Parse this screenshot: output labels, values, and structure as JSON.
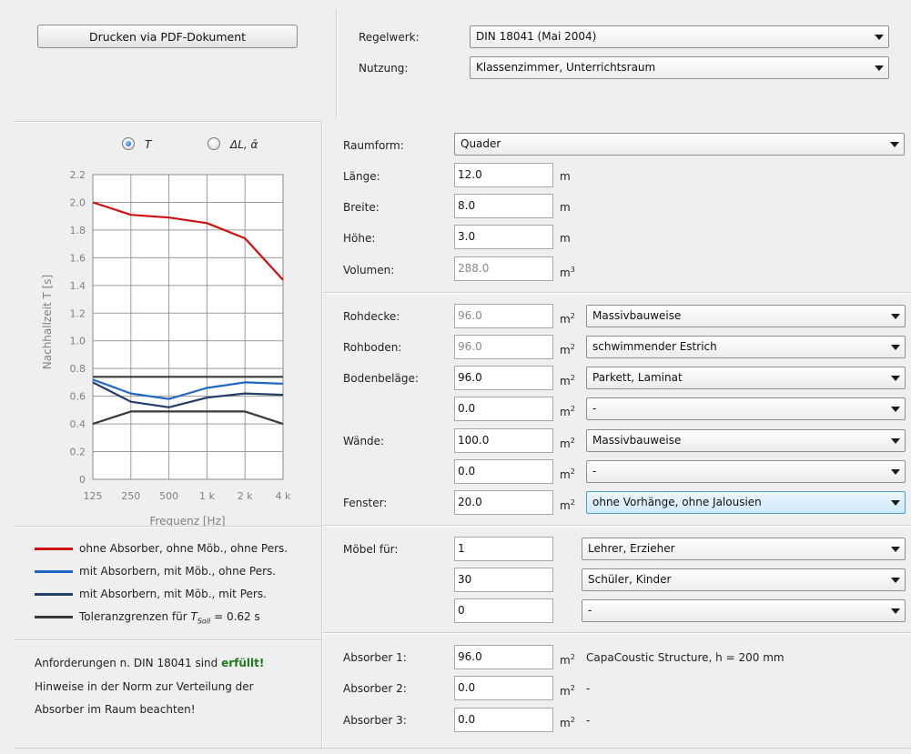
{
  "toolbar": {
    "print_button": "Drucken via PDF-Dokument"
  },
  "settings": {
    "regelwerk_label": "Regelwerk:",
    "regelwerk_value": "DIN 18041 (Mai 2004)",
    "nutzung_label": "Nutzung:",
    "nutzung_value": "Klassenzimmer, Unterrichtsraum"
  },
  "chart_toggle": {
    "opt_t": "T",
    "opt_dl": "ΔL, ᾱ",
    "selected": "T"
  },
  "chart_data": {
    "type": "line",
    "x": [
      "125",
      "250",
      "500",
      "1 k",
      "2 k",
      "4 k"
    ],
    "xlabel": "Frequenz [Hz]",
    "ylabel": "Nachhallzeit T [s]",
    "ylim": [
      0,
      2.2
    ],
    "yticks": [
      "0",
      "0.2",
      "0.4",
      "0.6",
      "0.8",
      "1.0",
      "1.2",
      "1.4",
      "1.6",
      "1.8",
      "2.0",
      "2.2"
    ],
    "grid": true,
    "series": [
      {
        "name": "ohne Absorber, ohne Möb., ohne Pers.",
        "color": "#d01010",
        "values": [
          2.0,
          1.91,
          1.89,
          1.85,
          1.74,
          1.44
        ]
      },
      {
        "name": "mit Absorbern, mit Möb., ohne Pers.",
        "color": "#1f67c4",
        "values": [
          0.72,
          0.62,
          0.58,
          0.66,
          0.7,
          0.69
        ]
      },
      {
        "name": "mit Absorbern, mit Möb., mit Pers.",
        "color": "#243f66",
        "values": [
          0.7,
          0.56,
          0.52,
          0.59,
          0.62,
          0.61
        ]
      },
      {
        "name": "Toleranzgrenzen für T_Soll = 0.62 s",
        "color": "#3a3a3a",
        "values": [
          0.74,
          0.74,
          0.74,
          0.74,
          0.74,
          0.74
        ]
      },
      {
        "name": "",
        "color": "#3a3a3a",
        "values": [
          0.4,
          0.49,
          0.49,
          0.49,
          0.49,
          0.4
        ]
      }
    ]
  },
  "legend": {
    "s1": "ohne Absorber, ohne Möb., ohne Pers.",
    "s2": "mit Absorbern, mit Möb., ohne Pers.",
    "s3": "mit Absorbern, mit Möb., mit Pers.",
    "s4_prefix": "Toleranzgrenzen für ",
    "s4_var": "T",
    "s4_sub": "Soll",
    "s4_suffix": " = 0.62 s"
  },
  "requirements": {
    "line1_prefix": "Anforderungen n. DIN 18041 sind ",
    "line1_status": "erfüllt!",
    "line2": "Hinweise in der Norm zur Verteilung der",
    "line3": "Absorber im Raum beachten!",
    "status_color": "#1a7a1a"
  },
  "room": {
    "raumform_label": "Raumform:",
    "raumform_value": "Quader",
    "laenge_label": "Länge:",
    "laenge_value": "12.0",
    "breite_label": "Breite:",
    "breite_value": "8.0",
    "hoehe_label": "Höhe:",
    "hoehe_value": "3.0",
    "volumen_label": "Volumen:",
    "volumen_value": "288.0",
    "unit_m": "m",
    "unit_m2": "m",
    "unit_m3": "m"
  },
  "surfaces": {
    "rohdecke_label": "Rohdecke:",
    "rohdecke_value": "96.0",
    "rohdecke_type": "Massivbauweise",
    "rohboden_label": "Rohboden:",
    "rohboden_value": "96.0",
    "rohboden_type": "schwimmender Estrich",
    "bodenbelaege_label": "Bodenbeläge:",
    "bodenbelaege_value1": "96.0",
    "bodenbelaege_type1": "Parkett, Laminat",
    "bodenbelaege_value2": "0.0",
    "bodenbelaege_type2": "-",
    "waende_label": "Wände:",
    "waende_value1": "100.0",
    "waende_type1": "Massivbauweise",
    "waende_value2": "0.0",
    "waende_type2": "-",
    "fenster_label": "Fenster:",
    "fenster_value": "20.0",
    "fenster_type": "ohne Vorhänge, ohne Jalousien"
  },
  "furniture": {
    "label": "Möbel für:",
    "row1_value": "1",
    "row1_type": "Lehrer, Erzieher",
    "row2_value": "30",
    "row2_type": "Schüler, Kinder",
    "row3_value": "0",
    "row3_type": "-"
  },
  "absorbers": {
    "a1_label": "Absorber 1:",
    "a1_value": "96.0",
    "a1_desc": "CapaCoustic Structure, h = 200 mm",
    "a2_label": "Absorber 2:",
    "a2_value": "0.0",
    "a2_desc": "-",
    "a3_label": "Absorber 3:",
    "a3_value": "0.0",
    "a3_desc": "-"
  }
}
